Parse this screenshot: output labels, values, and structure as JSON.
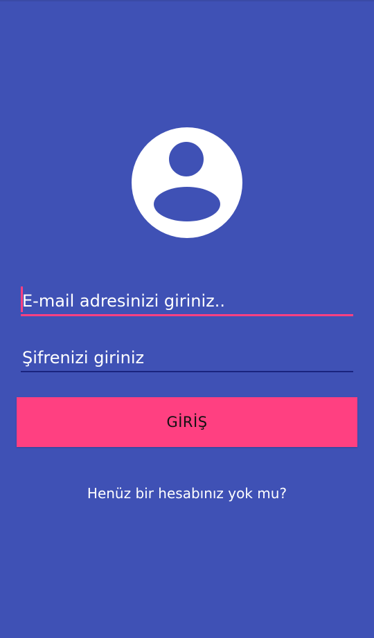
{
  "theme": {
    "background_color": "#3f51b5",
    "accent_color": "#ff4081",
    "avatar_color": "#ffffff"
  },
  "avatar": {
    "icon": "account-circle-icon"
  },
  "form": {
    "email": {
      "placeholder": "E-mail adresinizi giriniz..",
      "value": ""
    },
    "password": {
      "placeholder": "Şifrenizi giriniz",
      "value": ""
    },
    "login_label": "GİRİŞ"
  },
  "signup": {
    "link_text": "Henüz bir hesabınız yok mu?"
  }
}
